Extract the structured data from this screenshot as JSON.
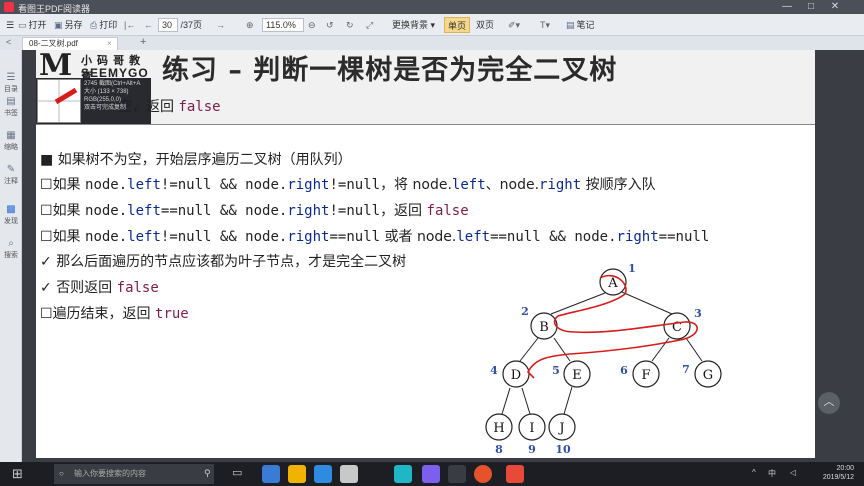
{
  "window": {
    "title": "看图王PDF阅读器",
    "minimize": "—",
    "maximize": "□",
    "close": "✕"
  },
  "toolbar": {
    "open_label": "打开",
    "saveas_label": "另存",
    "print_label": "打印",
    "page_current": "30",
    "page_total": "/37页",
    "zoom_value": "115.0%",
    "bg_label": "更换背景",
    "single_label": "单页",
    "double_label": "双页",
    "note_label": "笔记"
  },
  "tab": {
    "label": "08-二叉树.pdf",
    "close": "×",
    "add": "+"
  },
  "sidebar": [
    {
      "icon": "catalog-icon",
      "glyph": "☰",
      "label": "目录"
    },
    {
      "icon": "bookmark-icon",
      "glyph": "▤",
      "label": "书签"
    },
    {
      "icon": "thumbnail-icon",
      "glyph": "▦",
      "label": "缩略"
    },
    {
      "icon": "annotation-icon",
      "glyph": "✎",
      "label": "注释"
    },
    {
      "icon": "discover-icon",
      "glyph": "▩",
      "label": "发现"
    },
    {
      "icon": "search-icon",
      "glyph": "⌕",
      "label": "搜索"
    }
  ],
  "slide": {
    "logo_top": "小 码 哥 教 育",
    "logo_bottom": "SEEMYGO",
    "title": "练习 – 判断一棵树是否为完全二叉树",
    "line0": {
      "pre": "空，返回 ",
      "code": "false"
    },
    "lines": [
      {
        "bullet": "■",
        "text": "如果树不为空，开始层序遍历二叉树（用队列）"
      },
      {
        "bullet": "☐",
        "a": "如果 ",
        "b": "node.",
        "c": "left",
        "d": "!=null && node.",
        "e": "right",
        "f": "!=null",
        "g": "，将 node.",
        "h": "left",
        "i": "、node.",
        "j": "right",
        "k": " 按顺序入队"
      },
      {
        "bullet": "☐",
        "a": "如果 ",
        "b": "node.",
        "c": "left",
        "d": "==null && node.",
        "e": "right",
        "f": "!=null",
        "g": "，返回 ",
        "h": "false"
      },
      {
        "bullet": "☐",
        "a": "如果 ",
        "b": "node.",
        "c": "left",
        "d": "!=null && node.",
        "e": "right",
        "f": "==null",
        "g": " 或者 node.",
        "h": "left",
        "i": "==null && node.",
        "j": "right",
        "k": "==null"
      },
      {
        "bullet": "✓",
        "text": "那么后面遍历的节点应该都为叶子节点，才是完全二叉树"
      },
      {
        "bullet": "✓",
        "a": "否则返回 ",
        "code": "false"
      },
      {
        "bullet": "☐",
        "a": "遍历结束，返回 ",
        "code": "true"
      }
    ],
    "tree": {
      "nodes": [
        {
          "id": "A",
          "num": "1"
        },
        {
          "id": "B",
          "num": "2"
        },
        {
          "id": "C",
          "num": "3"
        },
        {
          "id": "D",
          "num": "4"
        },
        {
          "id": "E",
          "num": "5"
        },
        {
          "id": "F",
          "num": "6"
        },
        {
          "id": "G",
          "num": "7"
        },
        {
          "id": "H",
          "num": "8"
        },
        {
          "id": "I",
          "num": "9"
        },
        {
          "id": "J",
          "num": "10"
        }
      ]
    }
  },
  "tooltip": {
    "l1": "2745 截图(Ctrl+Alt+A",
    "l2": "大小 (133 × 738)",
    "l3": "RGB(255,0,0)",
    "l4": "双击可完成复制"
  },
  "taskbar": {
    "search_placeholder": "输入你要搜索的内容",
    "time": "20:00",
    "date": "2019/5/12",
    "ime": "中",
    "apps": [
      "#3a7bd5",
      "#f0b400",
      "#2e8bdf",
      "#1fb6c5",
      "#7d5ff0",
      "#e6522c",
      "#e84a3a"
    ]
  },
  "colors": {
    "accent": "#0b2a8a",
    "numlabel": "#2f4f9f",
    "red_ink": "#d81b1b"
  }
}
